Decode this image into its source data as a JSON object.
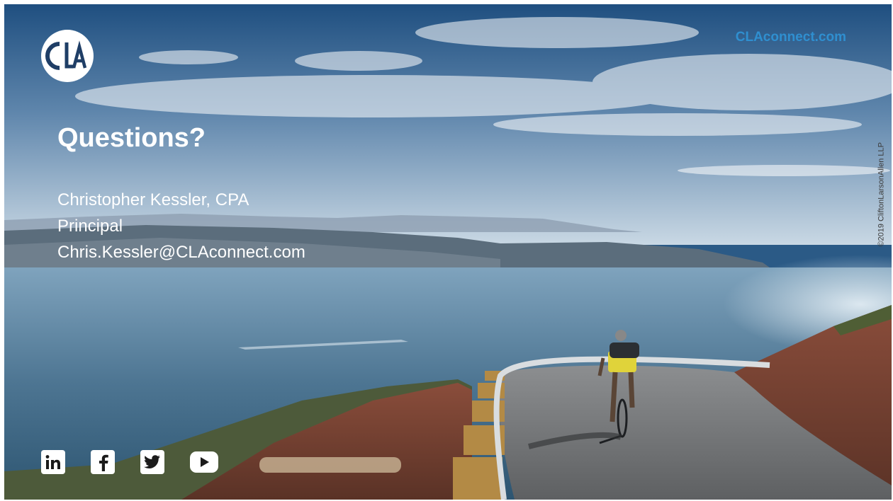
{
  "header": {
    "logo_icon": "cla-logo-icon",
    "site_link": "CLAconnect.com",
    "copyright": "©2019 CliftonLarsonAllen LLP"
  },
  "main": {
    "title": "Questions?",
    "contact": {
      "name": "Christopher Kessler, CPA",
      "role": "Principal",
      "email": "Chris.Kessler@CLAconnect.com"
    }
  },
  "footer": {
    "social_icons": [
      "linkedin-icon",
      "facebook-icon",
      "twitter-icon",
      "youtube-icon"
    ]
  },
  "colors": {
    "link": "#2f8fd0",
    "text": "#ffffff",
    "sky": "#2b5a86",
    "water": "#4f7896",
    "ground": "#7a4a3a"
  }
}
